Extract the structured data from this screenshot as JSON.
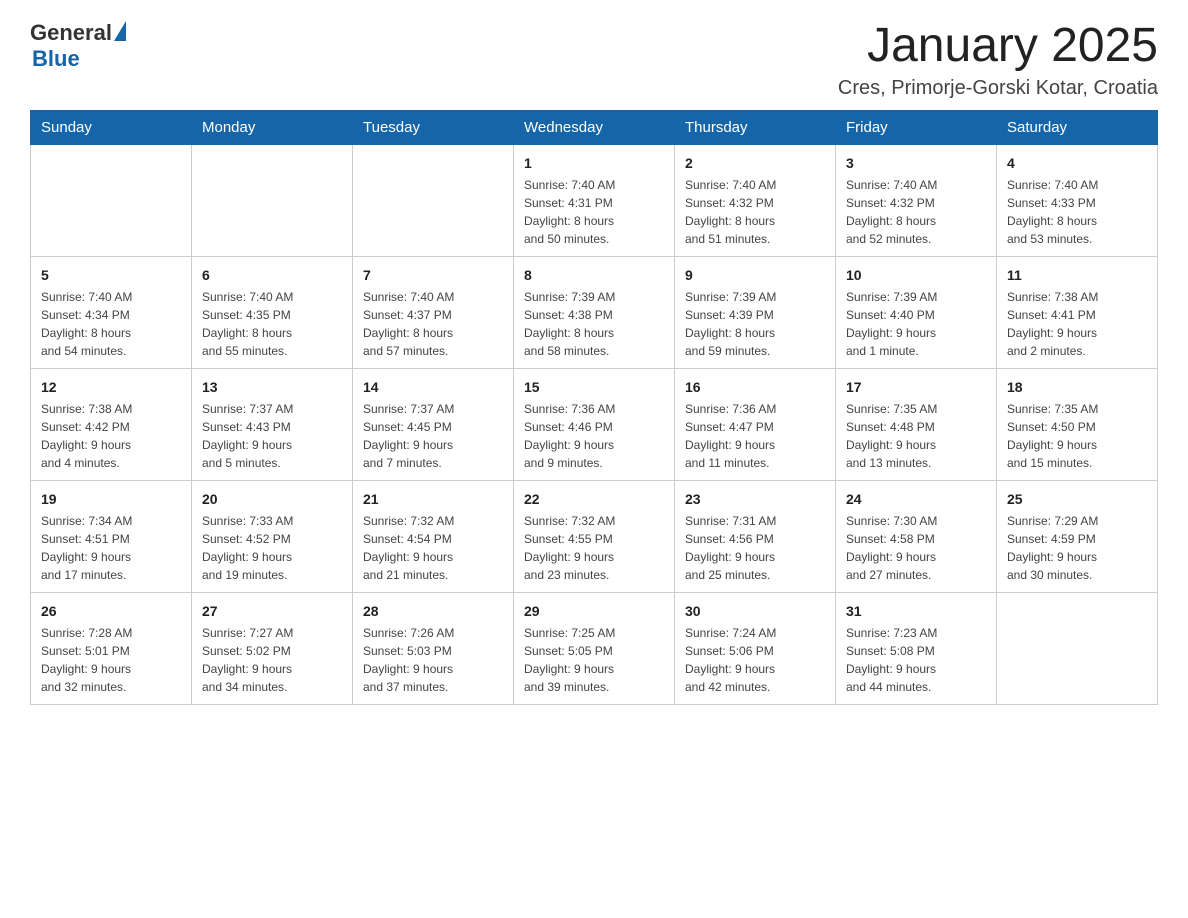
{
  "header": {
    "logo_general": "General",
    "logo_blue": "Blue",
    "month_title": "January 2025",
    "subtitle": "Cres, Primorje-Gorski Kotar, Croatia"
  },
  "days_of_week": [
    "Sunday",
    "Monday",
    "Tuesday",
    "Wednesday",
    "Thursday",
    "Friday",
    "Saturday"
  ],
  "weeks": [
    [
      {
        "day": "",
        "info": ""
      },
      {
        "day": "",
        "info": ""
      },
      {
        "day": "",
        "info": ""
      },
      {
        "day": "1",
        "info": "Sunrise: 7:40 AM\nSunset: 4:31 PM\nDaylight: 8 hours\nand 50 minutes."
      },
      {
        "day": "2",
        "info": "Sunrise: 7:40 AM\nSunset: 4:32 PM\nDaylight: 8 hours\nand 51 minutes."
      },
      {
        "day": "3",
        "info": "Sunrise: 7:40 AM\nSunset: 4:32 PM\nDaylight: 8 hours\nand 52 minutes."
      },
      {
        "day": "4",
        "info": "Sunrise: 7:40 AM\nSunset: 4:33 PM\nDaylight: 8 hours\nand 53 minutes."
      }
    ],
    [
      {
        "day": "5",
        "info": "Sunrise: 7:40 AM\nSunset: 4:34 PM\nDaylight: 8 hours\nand 54 minutes."
      },
      {
        "day": "6",
        "info": "Sunrise: 7:40 AM\nSunset: 4:35 PM\nDaylight: 8 hours\nand 55 minutes."
      },
      {
        "day": "7",
        "info": "Sunrise: 7:40 AM\nSunset: 4:37 PM\nDaylight: 8 hours\nand 57 minutes."
      },
      {
        "day": "8",
        "info": "Sunrise: 7:39 AM\nSunset: 4:38 PM\nDaylight: 8 hours\nand 58 minutes."
      },
      {
        "day": "9",
        "info": "Sunrise: 7:39 AM\nSunset: 4:39 PM\nDaylight: 8 hours\nand 59 minutes."
      },
      {
        "day": "10",
        "info": "Sunrise: 7:39 AM\nSunset: 4:40 PM\nDaylight: 9 hours\nand 1 minute."
      },
      {
        "day": "11",
        "info": "Sunrise: 7:38 AM\nSunset: 4:41 PM\nDaylight: 9 hours\nand 2 minutes."
      }
    ],
    [
      {
        "day": "12",
        "info": "Sunrise: 7:38 AM\nSunset: 4:42 PM\nDaylight: 9 hours\nand 4 minutes."
      },
      {
        "day": "13",
        "info": "Sunrise: 7:37 AM\nSunset: 4:43 PM\nDaylight: 9 hours\nand 5 minutes."
      },
      {
        "day": "14",
        "info": "Sunrise: 7:37 AM\nSunset: 4:45 PM\nDaylight: 9 hours\nand 7 minutes."
      },
      {
        "day": "15",
        "info": "Sunrise: 7:36 AM\nSunset: 4:46 PM\nDaylight: 9 hours\nand 9 minutes."
      },
      {
        "day": "16",
        "info": "Sunrise: 7:36 AM\nSunset: 4:47 PM\nDaylight: 9 hours\nand 11 minutes."
      },
      {
        "day": "17",
        "info": "Sunrise: 7:35 AM\nSunset: 4:48 PM\nDaylight: 9 hours\nand 13 minutes."
      },
      {
        "day": "18",
        "info": "Sunrise: 7:35 AM\nSunset: 4:50 PM\nDaylight: 9 hours\nand 15 minutes."
      }
    ],
    [
      {
        "day": "19",
        "info": "Sunrise: 7:34 AM\nSunset: 4:51 PM\nDaylight: 9 hours\nand 17 minutes."
      },
      {
        "day": "20",
        "info": "Sunrise: 7:33 AM\nSunset: 4:52 PM\nDaylight: 9 hours\nand 19 minutes."
      },
      {
        "day": "21",
        "info": "Sunrise: 7:32 AM\nSunset: 4:54 PM\nDaylight: 9 hours\nand 21 minutes."
      },
      {
        "day": "22",
        "info": "Sunrise: 7:32 AM\nSunset: 4:55 PM\nDaylight: 9 hours\nand 23 minutes."
      },
      {
        "day": "23",
        "info": "Sunrise: 7:31 AM\nSunset: 4:56 PM\nDaylight: 9 hours\nand 25 minutes."
      },
      {
        "day": "24",
        "info": "Sunrise: 7:30 AM\nSunset: 4:58 PM\nDaylight: 9 hours\nand 27 minutes."
      },
      {
        "day": "25",
        "info": "Sunrise: 7:29 AM\nSunset: 4:59 PM\nDaylight: 9 hours\nand 30 minutes."
      }
    ],
    [
      {
        "day": "26",
        "info": "Sunrise: 7:28 AM\nSunset: 5:01 PM\nDaylight: 9 hours\nand 32 minutes."
      },
      {
        "day": "27",
        "info": "Sunrise: 7:27 AM\nSunset: 5:02 PM\nDaylight: 9 hours\nand 34 minutes."
      },
      {
        "day": "28",
        "info": "Sunrise: 7:26 AM\nSunset: 5:03 PM\nDaylight: 9 hours\nand 37 minutes."
      },
      {
        "day": "29",
        "info": "Sunrise: 7:25 AM\nSunset: 5:05 PM\nDaylight: 9 hours\nand 39 minutes."
      },
      {
        "day": "30",
        "info": "Sunrise: 7:24 AM\nSunset: 5:06 PM\nDaylight: 9 hours\nand 42 minutes."
      },
      {
        "day": "31",
        "info": "Sunrise: 7:23 AM\nSunset: 5:08 PM\nDaylight: 9 hours\nand 44 minutes."
      },
      {
        "day": "",
        "info": ""
      }
    ]
  ]
}
